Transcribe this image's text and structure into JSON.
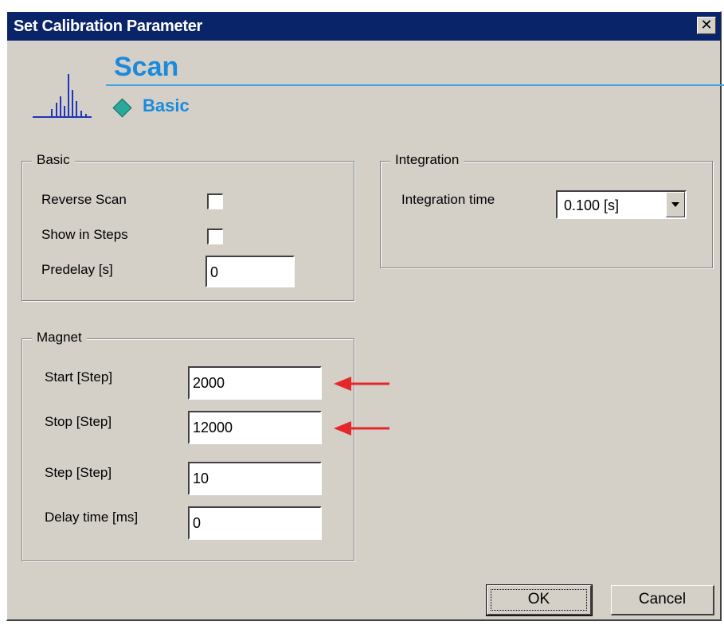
{
  "window": {
    "title": "Set Calibration Parameter",
    "close_symbol": "✕"
  },
  "header": {
    "title": "Scan",
    "subtitle": "Basic",
    "icon": "spectrum-icon",
    "accent_color": "#1a8bdc"
  },
  "basic_group": {
    "legend": "Basic",
    "reverse_scan": {
      "label": "Reverse Scan",
      "checked": false
    },
    "show_in_steps": {
      "label": "Show in Steps",
      "checked": false
    },
    "predelay": {
      "label": "Predelay [s]",
      "value": "0"
    }
  },
  "integration_group": {
    "legend": "Integration",
    "time_label": "Integration time",
    "time_value": "0.100 [s]"
  },
  "magnet_group": {
    "legend": "Magnet",
    "start": {
      "label": "Start [Step]",
      "value": "2000"
    },
    "stop": {
      "label": "Stop [Step]",
      "value": "12000"
    },
    "step": {
      "label": "Step [Step]",
      "value": "10"
    },
    "delay": {
      "label": "Delay time [ms]",
      "value": "0"
    }
  },
  "buttons": {
    "ok": "OK",
    "cancel": "Cancel"
  },
  "annotations": {
    "arrow_color": "#e8262a"
  }
}
